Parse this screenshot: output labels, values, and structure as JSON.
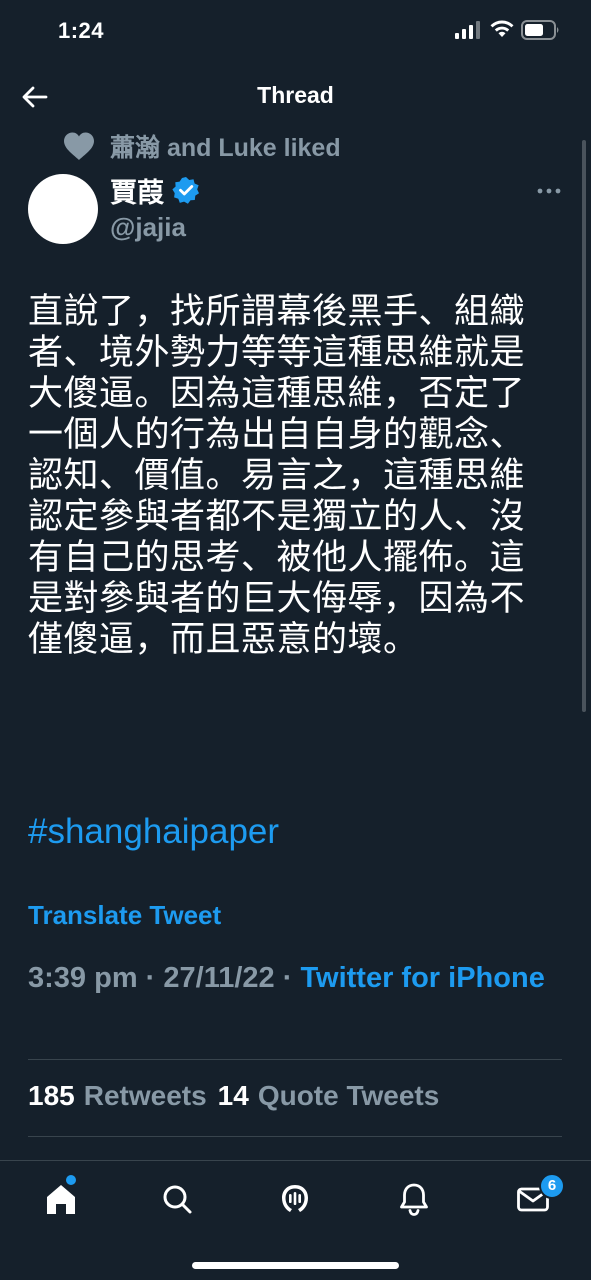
{
  "status_bar": {
    "time": "1:24"
  },
  "nav": {
    "title": "Thread"
  },
  "social_context": {
    "text": "蕭瀚 and Luke liked"
  },
  "author": {
    "name": "賈葭",
    "handle": "@jajia"
  },
  "tweet": {
    "text": "直說了，找所謂幕後黑手、組織者、境外勢力等等這種思維就是大傻逼。因為這種思維，否定了一個人的行為出自自身的觀念、認知、價值。易言之，這種思維認定參與者都不是獨立的人、沒有自己的思考、被他人擺佈。這是對參與者的巨大侮辱，因為不僅傻逼，而且惡意的壞。",
    "hashtag": "#shanghaipaper",
    "translate_label": "Translate Tweet",
    "time": "3:39 pm",
    "date": "27/11/22",
    "source": "Twitter for iPhone"
  },
  "stats": {
    "retweets_count": "185",
    "retweets_label": "Retweets",
    "quotes_count": "14",
    "quotes_label": "Quote Tweets"
  },
  "tab_bar": {
    "notifications_badge": "6"
  },
  "colors": {
    "background": "#15202b",
    "accent": "#1d9bf0",
    "secondary_text": "#8899a6",
    "divider": "#38444d"
  }
}
